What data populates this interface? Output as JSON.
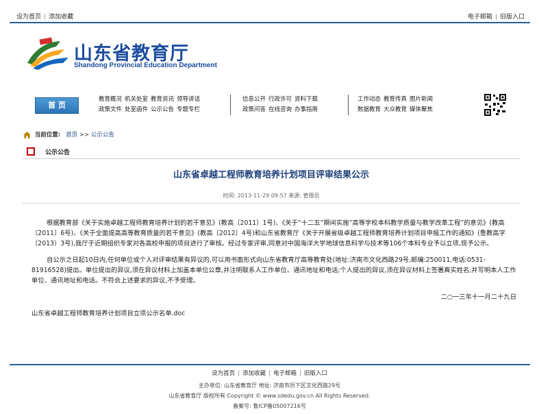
{
  "top_links": {
    "set_home": "设为首页",
    "add_fav": "添加收藏",
    "email": "电子邮箱",
    "old_site": "旧版入口"
  },
  "site": {
    "name_cn": "山东省教育厅",
    "name_en": "Shandong Provincial Education Department"
  },
  "nav": {
    "home": "首 页",
    "group1": [
      [
        "教育概况",
        "机关处室",
        "教育资讯",
        "领导讲话"
      ],
      [
        "政策文件",
        "处室函件",
        "公示公告",
        "专题专栏"
      ]
    ],
    "group2": [
      [
        "信息公开",
        "行政许可",
        "资料下载"
      ],
      [
        "政策问答",
        "在线咨询",
        "办事指南"
      ]
    ],
    "group3": [
      [
        "工作动态",
        "教育传真",
        "图片新闻"
      ],
      [
        "数据教育",
        "大众教育",
        "媒体聚焦"
      ]
    ]
  },
  "breadcrumb": {
    "label": "当前位置:",
    "home": "首页",
    "separator": ">>",
    "current": "公示公告"
  },
  "section_title": "公示公告",
  "article": {
    "title": "山东省卓越工程师教育培养计划项目评审结果公示",
    "meta": "时间: 2013-11-29 09:57  来源: 管理员",
    "paragraph1": "根据教育部《关于实施卓越工程师教育培养计划的若干意见》(教高〔2011〕1号)、《关于“十二五”期间实施“高等学校本科教学质量与教学改革工程”的意见》(教高〔2011〕6号)、《关于全面提高高等教育质量的若干意见》(教高〔2012〕4号)和山东省教育厅《关于开展省级卓越工程师教育培养计划项目申报工作的通知》(鲁教高字〔2013〕3号),我厅于近期组织专家对各高校申报的项目进行了审核。经过专家评审,同意对中国海洋大学地球信息科学与技术等106个本科专业予以立项,现予公示。",
    "paragraph2": "自公示之日起10日内,任何单位或个人对评审结果有异议的,可以用书面形式向山东省教育厅高等教育处(地址:济南市文化西路29号,邮编:250011,电话:0531-81916528)提出。单位提出的异议,须在异议材料上加盖本单位公章,并注明联系人工作单位、通讯地址和电话;个人提出的异议,须在异议材料上签署真实姓名,并写明本人工作单位、通讯地址和电话。不符合上述要求的异议,不予受理。",
    "date": "二○一三年十一月二十九日",
    "attachment": "山东省卓越工程师教育培养计划项目立项公示名单.doc"
  },
  "footer": {
    "links": [
      "设为首页",
      "添加收藏",
      "电子邮箱",
      "旧版入口"
    ],
    "sponsor": "主办单位: 山东省教育厅 地址: 济南市历下区文化西路29号",
    "copyright": "山东省教育厅 版权所有 Copyright © www.sdedu.gov.cn All Rights Reserved.",
    "icp": "备案号: 鲁ICP备05007216号"
  },
  "colors": {
    "brand_blue": "#2a5d94",
    "title_blue": "#1c4d9e",
    "accent_red": "#c00000"
  }
}
